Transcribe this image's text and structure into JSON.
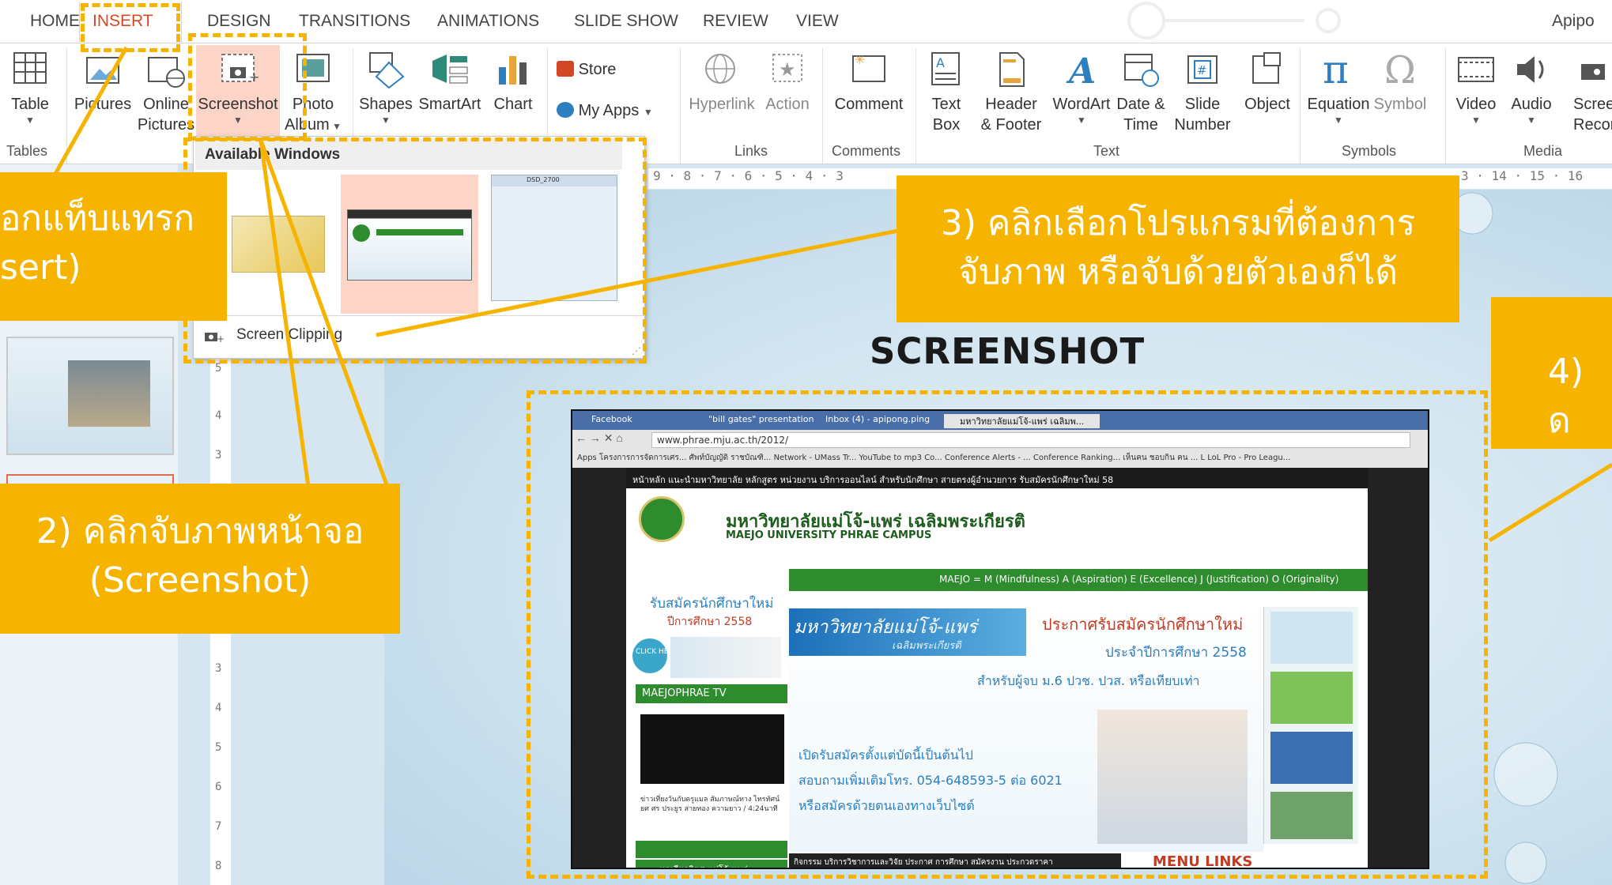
{
  "tabs": [
    "HOME",
    "INSERT",
    "DESIGN",
    "TRANSITIONS",
    "ANIMATIONS",
    "SLIDE SHOW",
    "REVIEW",
    "VIEW"
  ],
  "user_name": "Apipo",
  "ribbon": {
    "table": "Table",
    "pictures": "Pictures",
    "online_pictures_1": "Online",
    "online_pictures_2": "Pictures",
    "screenshot": "Screenshot",
    "photo_album_1": "Photo",
    "photo_album_2": "Album",
    "shapes": "Shapes",
    "smartart": "SmartArt",
    "chart": "Chart",
    "store": "Store",
    "my_apps": "My Apps",
    "hyperlink": "Hyperlink",
    "action": "Action",
    "comment": "Comment",
    "textbox_1": "Text",
    "textbox_2": "Box",
    "header_1": "Header",
    "header_2": "& Footer",
    "wordart": "WordArt",
    "datetime_1": "Date &",
    "datetime_2": "Time",
    "slidenum_1": "Slide",
    "slidenum_2": "Number",
    "object": "Object",
    "equation": "Equation",
    "symbol": "Symbol",
    "video": "Video",
    "audio": "Audio",
    "screen_rec_1": "Scree",
    "screen_rec_2": "Record",
    "groups": {
      "tables": "Tables",
      "links": "Links",
      "comments": "Comments",
      "text": "Text",
      "symbols": "Symbols",
      "media": "Media"
    }
  },
  "ruler_text": "9 · 8 · 7 · 6 · 5 · 4 · 3",
  "ruler_text_right": "3 · 14 · 15 · 16",
  "dropdown": {
    "header": "Available Windows",
    "clipping_label": "Screen Clipping",
    "thumb3_title": "DSD_2700"
  },
  "slide_title": "SCREENSHOT",
  "callouts": {
    "c1_line1": "อกแท็บแทรก",
    "c1_line2": "sert)",
    "c2_line1": "2) คลิกจับภาพหน้าจอ",
    "c2_line2": "(Screenshot)",
    "c3_line1": "3) คลิกเลือกโปรแกรมที่ต้องการ",
    "c3_line2": "จับภาพ หรือจับด้วยตัวเองก็ได้",
    "c4_line1": "4) ด"
  },
  "browser": {
    "tab1": "Facebook",
    "tab2": "\"bill gates\" presentation",
    "tab3": "Inbox (4) - apipong.ping",
    "tab4": "มหาวิทยาลัยแม่โจ้-แพร่ เฉลิมพ...",
    "url": "www.phrae.mju.ac.th/2012/",
    "bookmarks": "Apps   โครงการการจัดการเศร...   ศัพท์บัญญัติ ราชบัณฑิ...   Network - UMass Tr...   YouTube to mp3 Co...   Conference Alerts - ...   Conference Ranking...   เห็นคน ชอบกิน คน ... L   LoL Pro - Pro Leagu...",
    "nav": "หน้าหลัก  แนะนำมหาวิทยาลัย    หลักสูตร    หน่วยงาน    บริการออนไลน์    สำหรับนักศึกษา    สายตรงผู้อำนวยการ   รับสมัครนักศึกษาใหม่ 58",
    "uni_th": "มหาวิทยาลัยแม่โจ้-แพร่ เฉลิมพระเกียรติ",
    "uni_en": "MAEJO UNIVERSITY PHRAE CAMPUS",
    "motto": "MAEJO = M (Mindfulness) A (Aspiration) E (Excellence) J (Justification) O (Originality)",
    "admit1": "รับสมัครนักศึกษาใหม่",
    "admit2": "ปีการศึกษา 2558",
    "tv": "MAEJOPHRAE TV",
    "banner_title": "มหาวิทยาลัยแม่โจ้-แพร่",
    "banner_sub": "เฉลิมพระเกียรติ",
    "announce1": "ประกาศรับสมัครนักศึกษาใหม่",
    "announce2": "ประจำปีการศึกษา 2558",
    "announce3": "สำหรับผู้จบ ม.6 ปวช. ปวส. หรือเทียบเท่า",
    "open1": "เปิดรับสมัครตั้งแต่บัดนี้เป็นต้นไป",
    "open2": "สอบถามเพิ่มเติมโทร. 054-648593-5 ต่อ 6021",
    "open3": "หรือสมัครด้วยตนเองทางเว็บไซต์",
    "news": "ข่าวเที่ยงวันกับครูแมล สัมภาษณ์ทาง ไทรทัศน์ ยศ ศร ประยูร สายทอง ความยาว / 4:24นาที",
    "click_here": "CLICK HERE",
    "menu_links": "MENU LINKS",
    "tabs_bottom": "กิจกรรม    บริการวิชาการและวิจัย    ประกาศ    การศึกษา    สมัครงาน    ประกวดราคา",
    "footer_left": "หอเกียรติยศ แม่โจ้-แพร่"
  },
  "colors": {
    "accent": "#d24726",
    "callout": "#f6b400",
    "ribbon_bg": "#ffffff",
    "screenshot_btn_bg": "#fcd5c8"
  }
}
